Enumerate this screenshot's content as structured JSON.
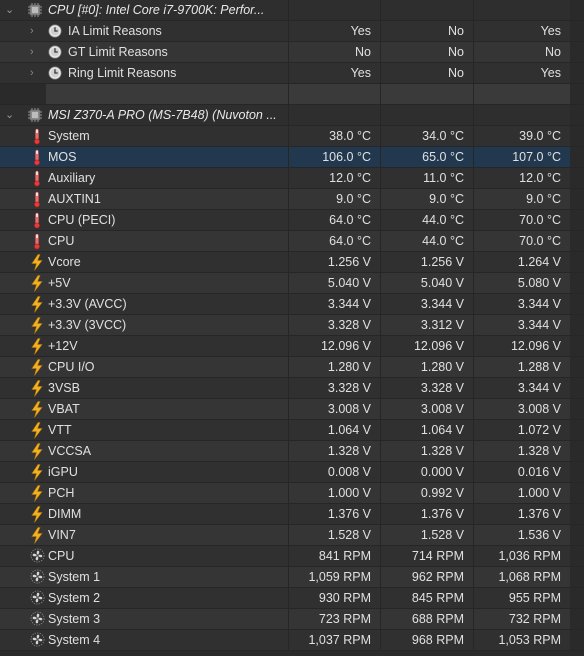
{
  "groups": [
    {
      "header": "CPU [#0]: Intel Core i7-9700K: Perfor...",
      "icon": "cpu-chip-icon",
      "rows": [
        {
          "label": "IA Limit Reasons",
          "icon": "limit-clock-icon",
          "v": [
            "Yes",
            "No",
            "Yes"
          ]
        },
        {
          "label": "GT Limit Reasons",
          "icon": "limit-clock-icon",
          "v": [
            "No",
            "No",
            "No"
          ]
        },
        {
          "label": "Ring Limit Reasons",
          "icon": "limit-clock-icon",
          "v": [
            "Yes",
            "No",
            "Yes"
          ]
        }
      ]
    },
    {
      "header": "MSI Z370-A PRO (MS-7B48) (Nuvoton ...",
      "icon": "motherboard-chip-icon",
      "rows": [
        {
          "label": "System",
          "icon": "thermometer-icon",
          "v": [
            "38.0 °C",
            "34.0 °C",
            "39.0 °C"
          ]
        },
        {
          "label": "MOS",
          "icon": "thermometer-icon",
          "v": [
            "106.0 °C",
            "65.0 °C",
            "107.0 °C"
          ],
          "selected": true
        },
        {
          "label": "Auxiliary",
          "icon": "thermometer-icon",
          "v": [
            "12.0 °C",
            "11.0 °C",
            "12.0 °C"
          ]
        },
        {
          "label": "AUXTIN1",
          "icon": "thermometer-icon",
          "v": [
            "9.0 °C",
            "9.0 °C",
            "9.0 °C"
          ]
        },
        {
          "label": "CPU (PECI)",
          "icon": "thermometer-icon",
          "v": [
            "64.0 °C",
            "44.0 °C",
            "70.0 °C"
          ]
        },
        {
          "label": "CPU",
          "icon": "thermometer-icon",
          "v": [
            "64.0 °C",
            "44.0 °C",
            "70.0 °C"
          ]
        },
        {
          "label": "Vcore",
          "icon": "voltage-bolt-icon",
          "v": [
            "1.256 V",
            "1.256 V",
            "1.264 V"
          ]
        },
        {
          "label": "+5V",
          "icon": "voltage-bolt-icon",
          "v": [
            "5.040 V",
            "5.040 V",
            "5.080 V"
          ]
        },
        {
          "label": "+3.3V (AVCC)",
          "icon": "voltage-bolt-icon",
          "v": [
            "3.344 V",
            "3.344 V",
            "3.344 V"
          ]
        },
        {
          "label": "+3.3V (3VCC)",
          "icon": "voltage-bolt-icon",
          "v": [
            "3.328 V",
            "3.312 V",
            "3.344 V"
          ]
        },
        {
          "label": "+12V",
          "icon": "voltage-bolt-icon",
          "v": [
            "12.096 V",
            "12.096 V",
            "12.096 V"
          ]
        },
        {
          "label": "CPU I/O",
          "icon": "voltage-bolt-icon",
          "v": [
            "1.280 V",
            "1.280 V",
            "1.288 V"
          ]
        },
        {
          "label": "3VSB",
          "icon": "voltage-bolt-icon",
          "v": [
            "3.328 V",
            "3.328 V",
            "3.344 V"
          ]
        },
        {
          "label": "VBAT",
          "icon": "voltage-bolt-icon",
          "v": [
            "3.008 V",
            "3.008 V",
            "3.008 V"
          ]
        },
        {
          "label": "VTT",
          "icon": "voltage-bolt-icon",
          "v": [
            "1.064 V",
            "1.064 V",
            "1.072 V"
          ]
        },
        {
          "label": "VCCSA",
          "icon": "voltage-bolt-icon",
          "v": [
            "1.328 V",
            "1.328 V",
            "1.328 V"
          ]
        },
        {
          "label": "iGPU",
          "icon": "voltage-bolt-icon",
          "v": [
            "0.008 V",
            "0.000 V",
            "0.016 V"
          ]
        },
        {
          "label": "PCH",
          "icon": "voltage-bolt-icon",
          "v": [
            "1.000 V",
            "0.992 V",
            "1.000 V"
          ]
        },
        {
          "label": "DIMM",
          "icon": "voltage-bolt-icon",
          "v": [
            "1.376 V",
            "1.376 V",
            "1.376 V"
          ]
        },
        {
          "label": "VIN7",
          "icon": "voltage-bolt-icon",
          "v": [
            "1.528 V",
            "1.528 V",
            "1.536 V"
          ]
        },
        {
          "label": "CPU",
          "icon": "fan-icon",
          "v": [
            "841 RPM",
            "714 RPM",
            "1,036 RPM"
          ]
        },
        {
          "label": "System 1",
          "icon": "fan-icon",
          "v": [
            "1,059 RPM",
            "962 RPM",
            "1,068 RPM"
          ]
        },
        {
          "label": "System 2",
          "icon": "fan-icon",
          "v": [
            "930 RPM",
            "845 RPM",
            "955 RPM"
          ]
        },
        {
          "label": "System 3",
          "icon": "fan-icon",
          "v": [
            "723 RPM",
            "688 RPM",
            "732 RPM"
          ]
        },
        {
          "label": "System 4",
          "icon": "fan-icon",
          "v": [
            "1,037 RPM",
            "968 RPM",
            "1,053 RPM"
          ]
        }
      ]
    }
  ],
  "colors": {
    "selected_row": "#22384f",
    "thermometer": "#e83a3a",
    "bolt": "#f2b120",
    "row_bg": "#303030",
    "row_alt_bg": "#353535"
  }
}
